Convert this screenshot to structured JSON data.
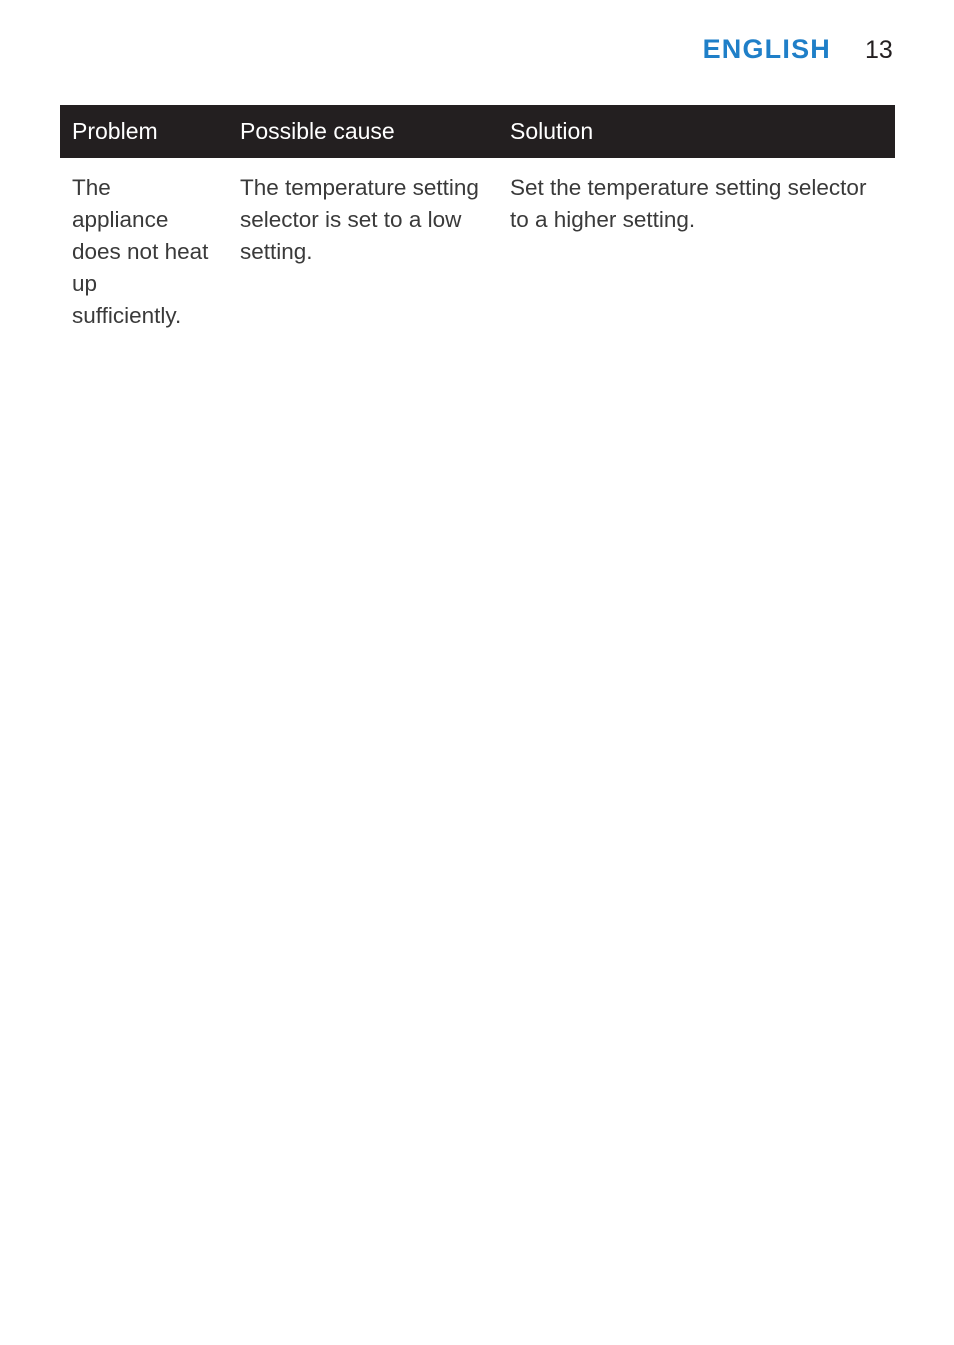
{
  "page": {
    "language_label": "ENGLISH",
    "page_number": "13",
    "accent_color": "#1f7fc8",
    "header_bar_color": "#231f20",
    "body_text_color": "#3a3a3a",
    "background_color": "#ffffff"
  },
  "table": {
    "columns": [
      "Problem",
      "Possible cause",
      "Solution"
    ],
    "rows": [
      {
        "problem": "The appliance does not heat up sufficiently.",
        "possible_cause": "The temperature setting selector is set to a low setting.",
        "solution": "Set the temperature setting selector to a higher setting."
      }
    ]
  }
}
